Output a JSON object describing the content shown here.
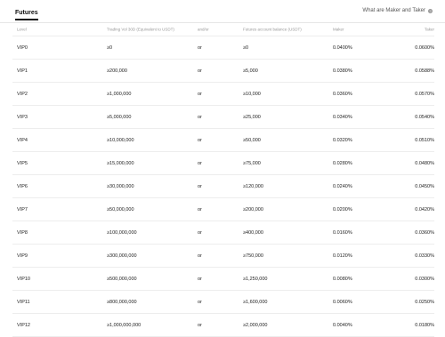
{
  "header": {
    "tab_label": "Futures",
    "maker_taker_link": "What are Maker and Taker",
    "help_icon": "?"
  },
  "table": {
    "columns": [
      "Level",
      "Trading Vol 30D (Equivalent to USDT)",
      "and/or",
      "Futures account balance (USDT)",
      "Maker",
      "Taker"
    ],
    "rows": [
      {
        "level": "VIP0",
        "vol": "≥0",
        "andor": "or",
        "balance": "≥0",
        "maker": "0.0400%",
        "taker": "0.0600%"
      },
      {
        "level": "VIP1",
        "vol": "≥200,000",
        "andor": "or",
        "balance": "≥5,000",
        "maker": "0.0380%",
        "taker": "0.0588%"
      },
      {
        "level": "VIP2",
        "vol": "≥1,000,000",
        "andor": "or",
        "balance": "≥10,000",
        "maker": "0.0360%",
        "taker": "0.0570%"
      },
      {
        "level": "VIP3",
        "vol": "≥5,000,000",
        "andor": "or",
        "balance": "≥25,000",
        "maker": "0.0340%",
        "taker": "0.0540%"
      },
      {
        "level": "VIP4",
        "vol": "≥10,000,000",
        "andor": "or",
        "balance": "≥50,000",
        "maker": "0.0320%",
        "taker": "0.0510%"
      },
      {
        "level": "VIP5",
        "vol": "≥15,000,000",
        "andor": "or",
        "balance": "≥75,000",
        "maker": "0.0280%",
        "taker": "0.0480%"
      },
      {
        "level": "VIP6",
        "vol": "≥30,000,000",
        "andor": "or",
        "balance": "≥120,000",
        "maker": "0.0240%",
        "taker": "0.0450%"
      },
      {
        "level": "VIP7",
        "vol": "≥50,000,000",
        "andor": "or",
        "balance": "≥200,000",
        "maker": "0.0200%",
        "taker": "0.0420%"
      },
      {
        "level": "VIP8",
        "vol": "≥100,000,000",
        "andor": "or",
        "balance": "≥400,000",
        "maker": "0.0160%",
        "taker": "0.0360%"
      },
      {
        "level": "VIP9",
        "vol": "≥300,000,000",
        "andor": "or",
        "balance": "≥750,000",
        "maker": "0.0120%",
        "taker": "0.0330%"
      },
      {
        "level": "VIP10",
        "vol": "≥500,000,000",
        "andor": "or",
        "balance": "≥1,250,000",
        "maker": "0.0080%",
        "taker": "0.0300%"
      },
      {
        "level": "VIP11",
        "vol": "≥800,000,000",
        "andor": "or",
        "balance": "≥1,600,000",
        "maker": "0.0060%",
        "taker": "0.0250%"
      },
      {
        "level": "VIP12",
        "vol": "≥1,000,000,000",
        "andor": "or",
        "balance": "≥2,000,000",
        "maker": "0.0040%",
        "taker": "0.0180%"
      }
    ]
  }
}
